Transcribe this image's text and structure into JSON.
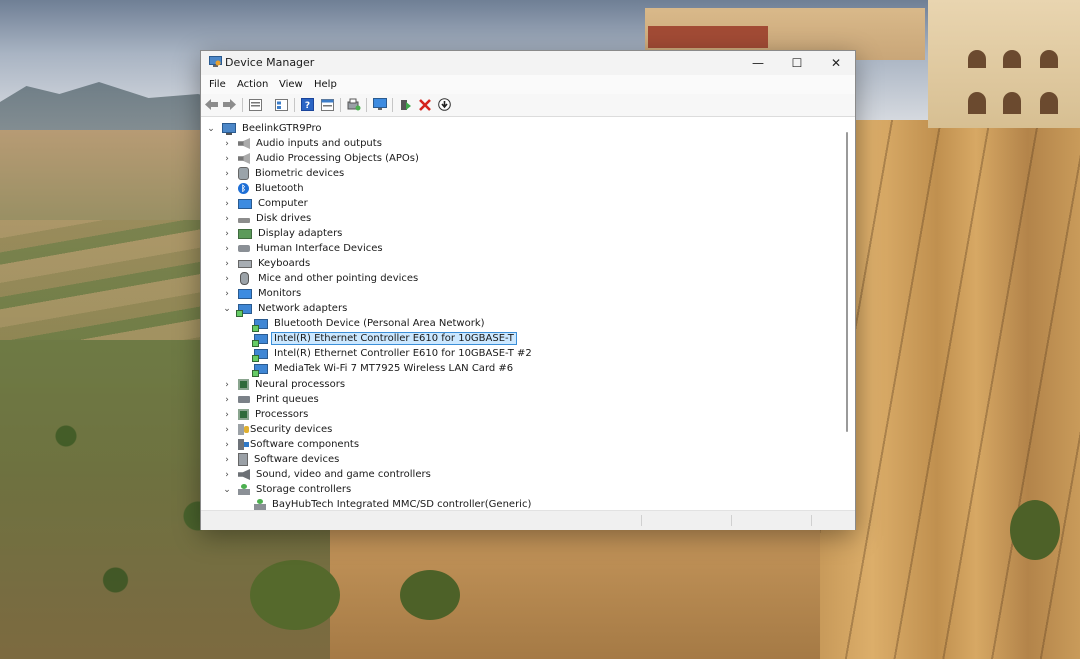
{
  "window": {
    "title": "Device Manager",
    "controls": {
      "minimize": "—",
      "maximize": "☐",
      "close": "✕"
    }
  },
  "menu": [
    "File",
    "Action",
    "View",
    "Help"
  ],
  "toolbar": [
    "back-icon",
    "forward-icon",
    "properties-view-icon",
    "device-list-icon",
    "help-icon",
    "resource-view-icon",
    "scan-icon",
    "monitor-icon",
    "update-driver-icon",
    "uninstall-icon",
    "download-icon"
  ],
  "tree": {
    "root": "BeelinkGTR9Pro",
    "categories": [
      {
        "label": "Audio inputs and outputs",
        "icon": "speaker-icon",
        "expanded": false
      },
      {
        "label": "Audio Processing Objects (APOs)",
        "icon": "speaker-icon",
        "expanded": false
      },
      {
        "label": "Biometric devices",
        "icon": "biometric-icon",
        "expanded": false
      },
      {
        "label": "Bluetooth",
        "icon": "bluetooth-icon",
        "expanded": false
      },
      {
        "label": "Computer",
        "icon": "computer-icon",
        "expanded": false
      },
      {
        "label": "Disk drives",
        "icon": "disk-icon",
        "expanded": false
      },
      {
        "label": "Display adapters",
        "icon": "display-adapter-icon",
        "expanded": false
      },
      {
        "label": "Human Interface Devices",
        "icon": "hid-icon",
        "expanded": false
      },
      {
        "label": "Keyboards",
        "icon": "keyboard-icon",
        "expanded": false
      },
      {
        "label": "Mice and other pointing devices",
        "icon": "mouse-icon",
        "expanded": false
      },
      {
        "label": "Monitors",
        "icon": "monitor-icon",
        "expanded": false
      },
      {
        "label": "Network adapters",
        "icon": "network-adapter-icon",
        "expanded": true,
        "children": [
          {
            "label": "Bluetooth Device (Personal Area Network)",
            "selected": false
          },
          {
            "label": "Intel(R) Ethernet Controller E610 for 10GBASE-T",
            "selected": true
          },
          {
            "label": "Intel(R) Ethernet Controller E610 for 10GBASE-T #2",
            "selected": false
          },
          {
            "label": "MediaTek Wi-Fi 7 MT7925 Wireless LAN Card #6",
            "selected": false
          }
        ]
      },
      {
        "label": "Neural processors",
        "icon": "chip-icon",
        "expanded": false
      },
      {
        "label": "Print queues",
        "icon": "printer-icon",
        "expanded": false
      },
      {
        "label": "Processors",
        "icon": "chip-icon",
        "expanded": false
      },
      {
        "label": "Security devices",
        "icon": "security-icon",
        "expanded": false
      },
      {
        "label": "Software components",
        "icon": "software-component-icon",
        "expanded": false
      },
      {
        "label": "Software devices",
        "icon": "software-device-icon",
        "expanded": false
      },
      {
        "label": "Sound, video and game controllers",
        "icon": "sound-icon",
        "expanded": false
      },
      {
        "label": "Storage controllers",
        "icon": "storage-controller-icon",
        "expanded": true,
        "children": [
          {
            "label": "BayHubTech Integrated MMC/SD controller(Generic)",
            "selected": false
          }
        ]
      }
    ]
  }
}
